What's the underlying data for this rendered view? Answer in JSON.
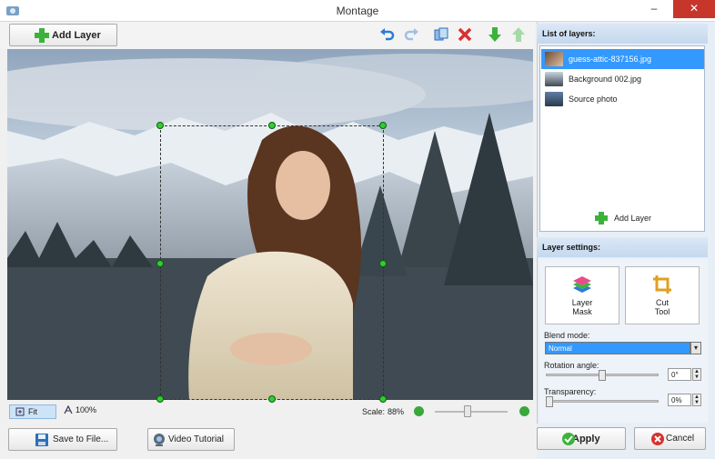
{
  "window": {
    "title": "Montage"
  },
  "toolbar": {
    "add_layer_label": "Add Layer",
    "icons": [
      "undo-icon",
      "redo-icon",
      "copy-icon",
      "delete-icon",
      "move-down-icon",
      "move-up-icon"
    ]
  },
  "canvas": {
    "fit_label": "Fit",
    "zoom_100_label": "100%",
    "scale_label": "Scale:",
    "scale_value": "88%",
    "scale_fraction": 0.5
  },
  "footer": {
    "save_label": "Save to File...",
    "video_label": "Video Tutorial",
    "apply_label": "Apply",
    "cancel_label": "Cancel"
  },
  "layers": {
    "header": "List of layers:",
    "items": [
      {
        "name": "guess-attic-837156.jpg",
        "selected": true
      },
      {
        "name": "Background 002.jpg",
        "selected": false
      },
      {
        "name": "Source photo",
        "selected": false
      }
    ],
    "add_label": "Add Layer"
  },
  "settings": {
    "header": "Layer settings:",
    "layer_mask_label_1": "Layer",
    "layer_mask_label_2": "Mask",
    "cut_tool_label_1": "Cut",
    "cut_tool_label_2": "Tool",
    "blend_mode_label": "Blend mode:",
    "blend_mode_value": "Normal",
    "rotation_label": "Rotation angle:",
    "rotation_value": "0°",
    "rotation_fraction": 0.5,
    "transparency_label": "Transparency:",
    "transparency_value": "0%",
    "transparency_fraction": 0.0
  },
  "colors": {
    "accent": "#3399ff",
    "green": "#33cc33",
    "red": "#d83030"
  }
}
